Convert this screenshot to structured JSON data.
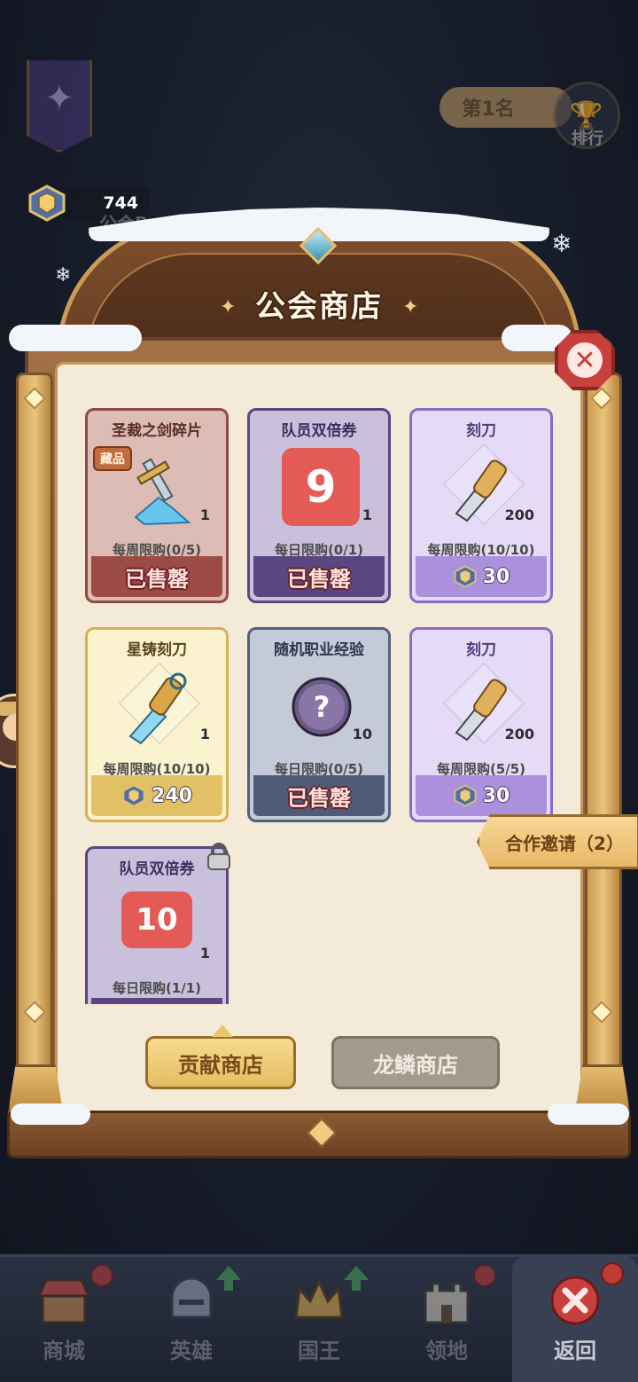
{
  "hud": {
    "rank_text": "第1名",
    "rank_label": "排行",
    "currency_value": "744",
    "boss_label": "公会Boss"
  },
  "shop": {
    "title": "公会商店",
    "items": [
      {
        "name": "圣裁之剑碎片",
        "tag": "藏品",
        "qty": "1",
        "limit": "每周限购(0/5)",
        "footer": "已售罄"
      },
      {
        "name": "队员双倍券",
        "tile": "9",
        "qty": "1",
        "limit": "每日限购(0/1)",
        "footer": "已售罄"
      },
      {
        "name": "刻刀",
        "qty": "200",
        "limit": "每周限购(10/10)",
        "price": "30"
      },
      {
        "name": "星铸刻刀",
        "qty": "1",
        "limit": "每周限购(10/10)",
        "price": "240"
      },
      {
        "name": "随机职业经验",
        "qty": "10",
        "limit": "每日限购(0/5)",
        "footer": "已售罄"
      },
      {
        "name": "刻刀",
        "qty": "200",
        "limit": "每周限购(5/5)",
        "price": "30"
      },
      {
        "name": "队员双倍券",
        "tile": "10",
        "qty": "1",
        "limit": "每日限购(1/1)"
      }
    ],
    "tabs": {
      "active": "贡献商店",
      "inactive": "龙鳞商店"
    },
    "coop_button": "合作邀请（2）"
  },
  "nav": {
    "items": [
      {
        "label": "商城"
      },
      {
        "label": "英雄"
      },
      {
        "label": "国王"
      },
      {
        "label": "领地"
      },
      {
        "label": "返回"
      }
    ]
  },
  "colors": {
    "sold_red": "#9c4b45",
    "price_lilac": "#ab90de",
    "gold": "#e2c066",
    "close_red": "#c8403d"
  }
}
